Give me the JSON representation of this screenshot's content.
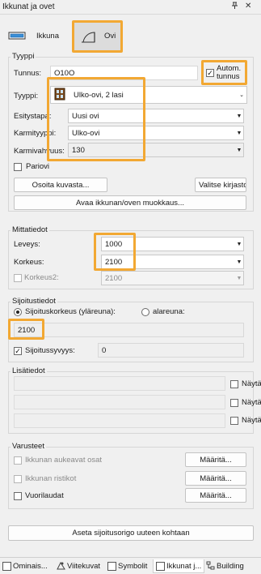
{
  "window": {
    "title": "Ikkunat ja ovet",
    "pin_icon": "pin-icon",
    "close_glyph": "✕"
  },
  "types": {
    "window_label": "Ikkuna",
    "door_label": "Ovi"
  },
  "tyyppi": {
    "group_title": "Tyyppi",
    "tunnus_label": "Tunnus:",
    "tunnus_value": "O10O",
    "autom_label_1": "Autom.",
    "autom_label_2": "tunnus",
    "autom_checked": "✓",
    "tyyppi_label": "Tyyppi:",
    "tyyppi_value": "Ulko-ovi, 2 lasi",
    "esitystapa_label": "Esitystapa:",
    "esitystapa_value": "Uusi ovi",
    "karmityyppi_label": "Karmityyppi:",
    "karmityyppi_value": "Ulko-ovi",
    "karmivahvuus_label": "Karmivahvuus:",
    "karmivahvuus_value": "130",
    "pariovi_label": "Pariovi",
    "osoita_button": "Osoita kuvasta...",
    "valitse_button": "Valitse kirjastosta...",
    "avaa_button": "Avaa ikkunan/oven muokkaus..."
  },
  "mittatiedot": {
    "group_title": "Mittatiedot",
    "leveys_label": "Leveys:",
    "leveys_value": "1000",
    "korkeus_label": "Korkeus:",
    "korkeus_value": "2100",
    "korkeus2_label": "Korkeus2:",
    "korkeus2_value": "2100"
  },
  "sijoitustiedot": {
    "group_title": "Sijoitustiedot",
    "radio_top_label": "Sijoituskorkeus (yläreuna):",
    "radio_bottom_label": "alareuna:",
    "height_value": "2100",
    "syvyys_label": "Sijoitussyvyys:",
    "syvyys_checked": "✓",
    "syvyys_value": "0"
  },
  "lisatiedot": {
    "group_title": "Lisätiedot",
    "nayta_label": "Näytä"
  },
  "varusteet": {
    "group_title": "Varusteet",
    "item1": "Ikkunan aukeavat osat",
    "item2": "Ikkunan ristikot",
    "item3": "Vuorilaudat",
    "maarita_button": "Määritä..."
  },
  "footer_button": "Aseta sijoitusorigo uuteen kohtaan",
  "tabs": [
    {
      "label": "Ominais..."
    },
    {
      "label": "Viitekuvat"
    },
    {
      "label": "Symbolit"
    },
    {
      "label": "Ikkunat j..."
    },
    {
      "label": "Building"
    }
  ],
  "colors": {
    "highlight": "#f2a833",
    "background": "#f0f0f0"
  }
}
